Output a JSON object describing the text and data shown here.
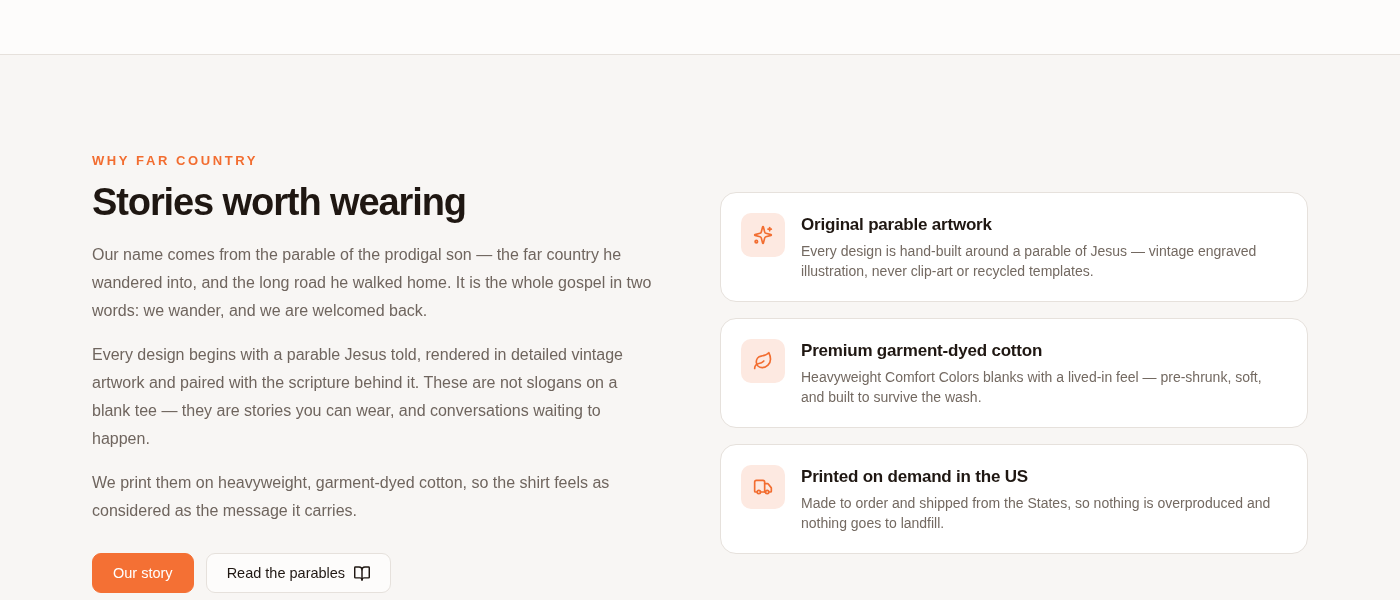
{
  "section": {
    "eyebrow": "WHY FAR COUNTRY",
    "heading": "Stories worth wearing",
    "paragraphs": [
      "Our name comes from the parable of the prodigal son — the far country he wandered into, and the long road he walked home. It is the whole gospel in two words: we wander, and we are welcomed back.",
      "Every design begins with a parable Jesus told, rendered in detailed vintage artwork and paired with the scripture behind it. These are not slogans on a blank tee — they are stories you can wear, and conversations waiting to happen.",
      "We print them on heavyweight, garment-dyed cotton, so the shirt feels as considered as the message it carries."
    ],
    "buttons": [
      {
        "label": "Our story",
        "kind": "primary"
      },
      {
        "label": "Read the parables",
        "kind": "secondary"
      }
    ]
  },
  "features": [
    {
      "title": "Original parable artwork",
      "description": "Every design is hand-built around a parable of Jesus — vintage engraved illustration, never clip-art or recycled templates."
    },
    {
      "title": "Premium garment-dyed cotton",
      "description": "Heavyweight Comfort Colors blanks with a lived-in feel — pre-shrunk, soft, and built to survive the wash."
    },
    {
      "title": "Printed on demand in the US",
      "description": "Made to order and shipped from the States, so nothing is overproduced and nothing goes to landfill."
    }
  ]
}
